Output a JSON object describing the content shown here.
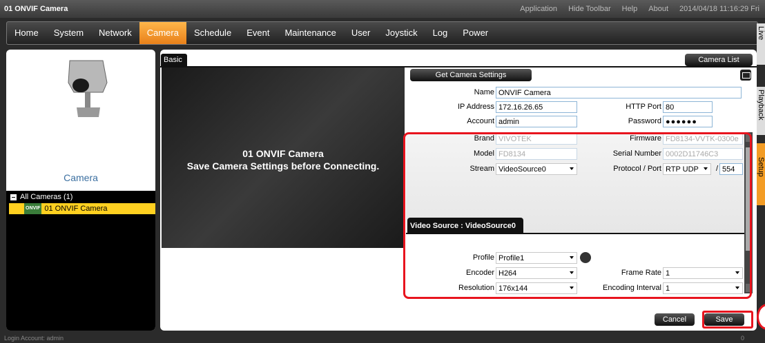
{
  "window": {
    "title": "01 ONVIF Camera",
    "menu": [
      "Application",
      "Hide Toolbar",
      "Help",
      "About"
    ],
    "datetime": "2014/04/18 11:16:29 Fri"
  },
  "nav": {
    "tabs": [
      "Home",
      "System",
      "Network",
      "Camera",
      "Schedule",
      "Event",
      "Maintenance",
      "User",
      "Joystick",
      "Log",
      "Power"
    ],
    "active": "Camera"
  },
  "sidebar": {
    "camera_label": "Camera",
    "tree_root": "All Cameras (1)",
    "tree_node": "01  ONVIF Camera",
    "node_badge": "ONVIF"
  },
  "main": {
    "basic_tab": "Basic",
    "camera_list_button": "Camera List",
    "preview_line1": "01 ONVIF Camera",
    "preview_line2": "Save Camera Settings before Connecting."
  },
  "form": {
    "get_settings_button": "Get Camera Settings",
    "name_label": "Name",
    "name_value": "ONVIF Camera",
    "ip_label": "IP Address",
    "ip_value": "172.16.26.65",
    "http_port_label": "HTTP Port",
    "http_port_value": "80",
    "account_label": "Account",
    "account_value": "admin",
    "password_label": "Password",
    "password_value": "●●●●●●",
    "brand_label": "Brand",
    "brand_value": "VIVOTEK",
    "firmware_label": "Firmware",
    "firmware_value": "FD8134-VVTK-0300e",
    "model_label": "Model",
    "model_value": "FD8134",
    "serial_label": "Serial Number",
    "serial_value": "0002D11746C3",
    "stream_label": "Stream",
    "stream_value": "VideoSource0",
    "protocol_label": "Protocol / Port",
    "protocol_value": "RTP UDP",
    "port_slash": "/",
    "port_value": "554",
    "video_source_tab": "Video Source : VideoSource0",
    "profile_label": "Profile",
    "profile_value": "Profile1",
    "encoder_label": "Encoder",
    "encoder_value": "H264",
    "frame_rate_label": "Frame Rate",
    "frame_rate_value": "1",
    "resolution_label": "Resolution",
    "resolution_value": "176x144",
    "encoding_interval_label": "Encoding Interval",
    "encoding_interval_value": "1",
    "cancel_button": "Cancel",
    "save_button": "Save"
  },
  "side_tabs": [
    "Live",
    "Playback",
    "Setup"
  ],
  "status": {
    "account": "Login Account: admin",
    "count": "0"
  },
  "colors": {
    "accent": "#f39c24",
    "highlight": "#e8141e",
    "tree_selected": "#ffd020"
  }
}
